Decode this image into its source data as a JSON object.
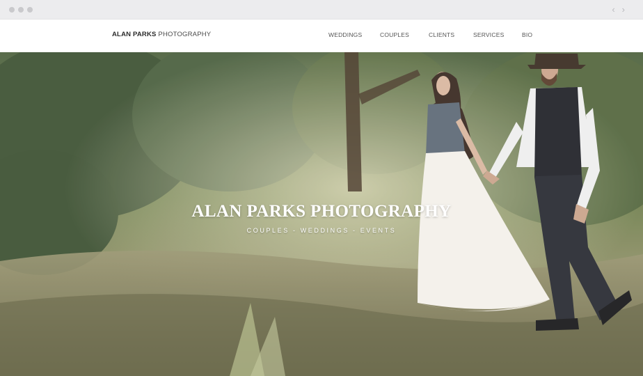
{
  "browser": {
    "back_icon": "‹",
    "forward_icon": "›"
  },
  "header": {
    "brand_bold": "ALAN PARKS",
    "brand_light": "PHOTOGRAPHY",
    "menu": [
      {
        "label": "WEDDINGS"
      },
      {
        "label": "COUPLES"
      },
      {
        "label": "CLIENTS"
      },
      {
        "label": "SERVICES"
      },
      {
        "label": "BIO"
      }
    ]
  },
  "hero": {
    "title": "ALAN PARKS PHOTOGRAPHY",
    "subtitle": "COUPLES - WEDDINGS - EVENTS"
  },
  "colors": {
    "header_background": "#ffffff",
    "titlebar": "#ececee",
    "brand_text": "#2b2b2b",
    "menu_text": "#555555",
    "hero_text": "#ffffff"
  }
}
